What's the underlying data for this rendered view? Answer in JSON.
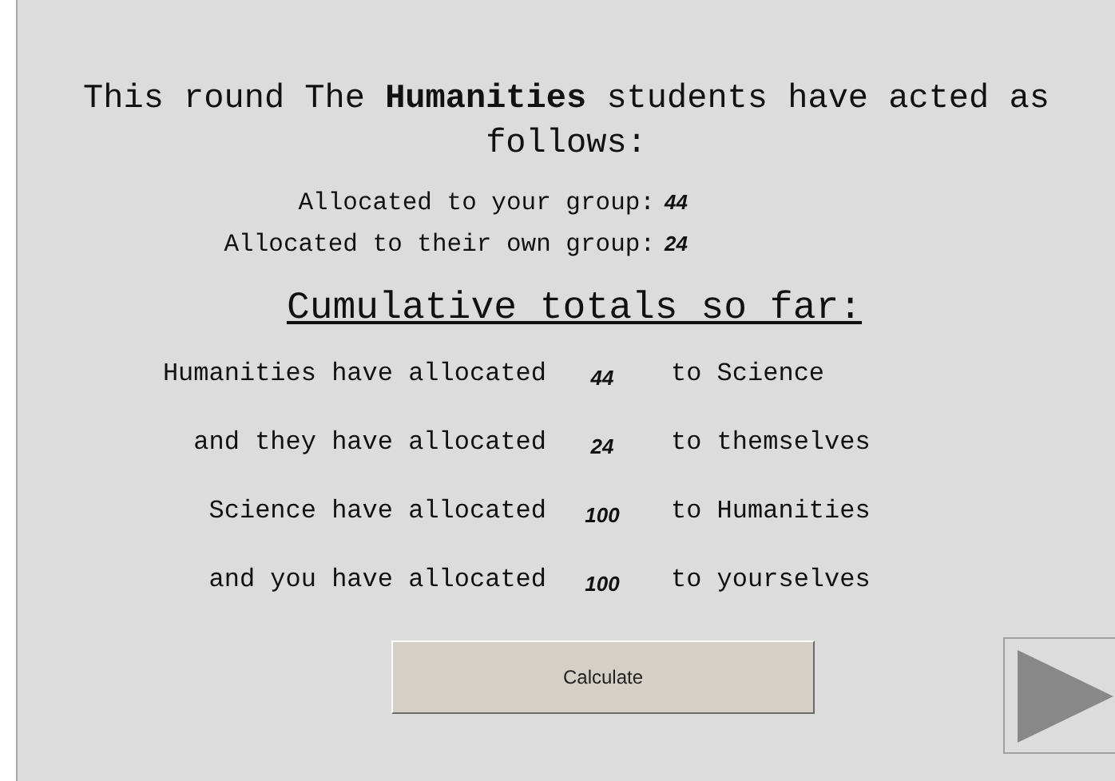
{
  "heading": "This round The **Humanities** students have acted as follows:",
  "this_round": [
    {
      "label": "Allocated to your group:",
      "value": "44"
    },
    {
      "label": "Allocated to their own group:",
      "value": "24"
    }
  ],
  "totals_title": "Cumulative totals so far:",
  "totals": [
    {
      "label": "Humanities have allocated",
      "value": "44",
      "target": "to Science"
    },
    {
      "label": "and they have allocated",
      "value": "24",
      "target": "to themselves"
    },
    {
      "label": "Science have allocated",
      "value": "100",
      "target": "to Humanities"
    },
    {
      "label": "and you have allocated",
      "value": "100",
      "target": "to yourselves"
    }
  ],
  "calculate_button": "Calculate"
}
